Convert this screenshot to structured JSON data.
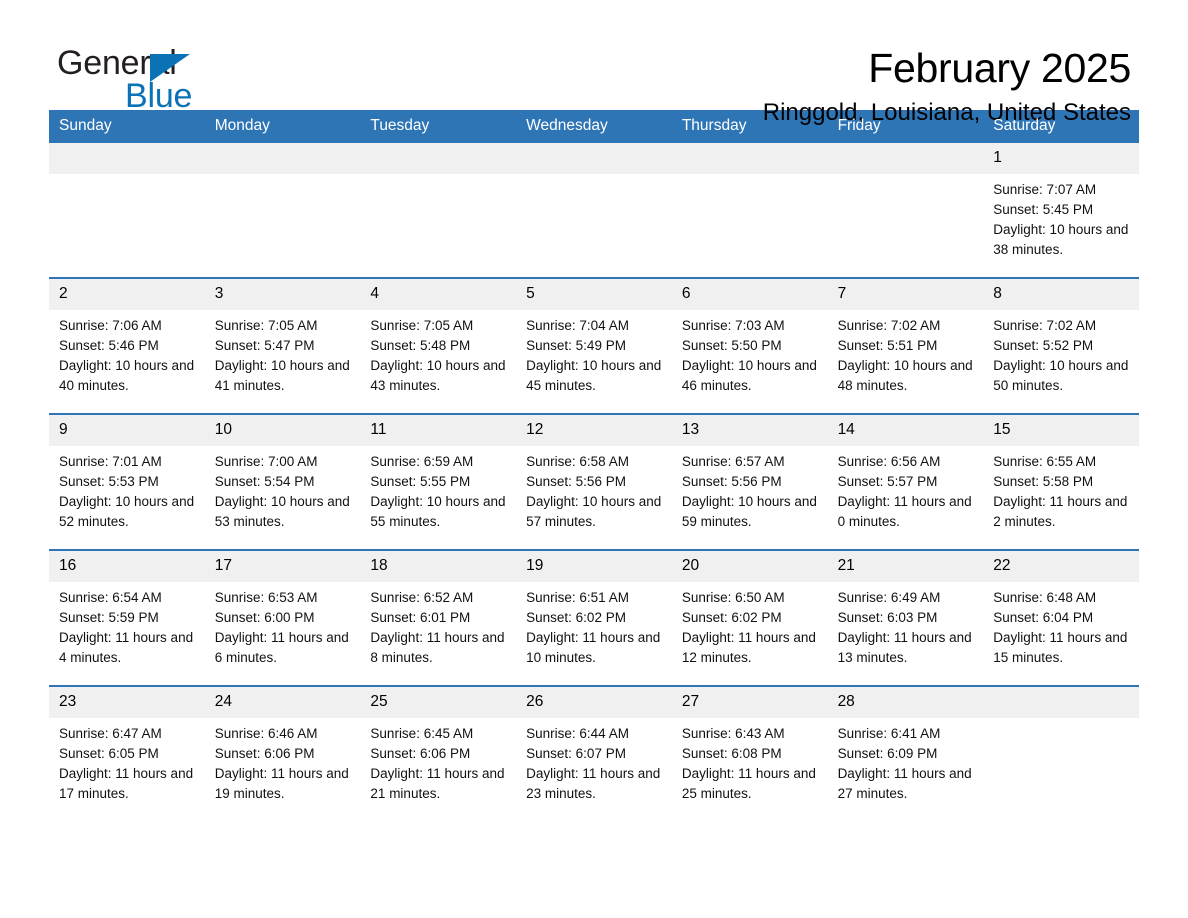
{
  "brand": {
    "name_part1": "General",
    "name_part2": "Blue",
    "accent_color": "#0b72b5"
  },
  "header": {
    "title": "February 2025",
    "subtitle": "Ringgold, Louisiana, United States",
    "header_bg": "#2e75b6",
    "daynum_bg": "#f0f0f0"
  },
  "weekdays": [
    "Sunday",
    "Monday",
    "Tuesday",
    "Wednesday",
    "Thursday",
    "Friday",
    "Saturday"
  ],
  "labels": {
    "sunrise": "Sunrise:",
    "sunset": "Sunset:",
    "daylight": "Daylight:"
  },
  "weeks": [
    [
      {
        "day": "",
        "sunrise": "",
        "sunset": "",
        "daylight": "",
        "empty": true
      },
      {
        "day": "",
        "sunrise": "",
        "sunset": "",
        "daylight": "",
        "empty": true
      },
      {
        "day": "",
        "sunrise": "",
        "sunset": "",
        "daylight": "",
        "empty": true
      },
      {
        "day": "",
        "sunrise": "",
        "sunset": "",
        "daylight": "",
        "empty": true
      },
      {
        "day": "",
        "sunrise": "",
        "sunset": "",
        "daylight": "",
        "empty": true
      },
      {
        "day": "",
        "sunrise": "",
        "sunset": "",
        "daylight": "",
        "empty": true
      },
      {
        "day": "1",
        "sunrise": "Sunrise: 7:07 AM",
        "sunset": "Sunset: 5:45 PM",
        "daylight": "Daylight: 10 hours and 38 minutes.",
        "empty": false
      }
    ],
    [
      {
        "day": "2",
        "sunrise": "Sunrise: 7:06 AM",
        "sunset": "Sunset: 5:46 PM",
        "daylight": "Daylight: 10 hours and 40 minutes.",
        "empty": false
      },
      {
        "day": "3",
        "sunrise": "Sunrise: 7:05 AM",
        "sunset": "Sunset: 5:47 PM",
        "daylight": "Daylight: 10 hours and 41 minutes.",
        "empty": false
      },
      {
        "day": "4",
        "sunrise": "Sunrise: 7:05 AM",
        "sunset": "Sunset: 5:48 PM",
        "daylight": "Daylight: 10 hours and 43 minutes.",
        "empty": false
      },
      {
        "day": "5",
        "sunrise": "Sunrise: 7:04 AM",
        "sunset": "Sunset: 5:49 PM",
        "daylight": "Daylight: 10 hours and 45 minutes.",
        "empty": false
      },
      {
        "day": "6",
        "sunrise": "Sunrise: 7:03 AM",
        "sunset": "Sunset: 5:50 PM",
        "daylight": "Daylight: 10 hours and 46 minutes.",
        "empty": false
      },
      {
        "day": "7",
        "sunrise": "Sunrise: 7:02 AM",
        "sunset": "Sunset: 5:51 PM",
        "daylight": "Daylight: 10 hours and 48 minutes.",
        "empty": false
      },
      {
        "day": "8",
        "sunrise": "Sunrise: 7:02 AM",
        "sunset": "Sunset: 5:52 PM",
        "daylight": "Daylight: 10 hours and 50 minutes.",
        "empty": false
      }
    ],
    [
      {
        "day": "9",
        "sunrise": "Sunrise: 7:01 AM",
        "sunset": "Sunset: 5:53 PM",
        "daylight": "Daylight: 10 hours and 52 minutes.",
        "empty": false
      },
      {
        "day": "10",
        "sunrise": "Sunrise: 7:00 AM",
        "sunset": "Sunset: 5:54 PM",
        "daylight": "Daylight: 10 hours and 53 minutes.",
        "empty": false
      },
      {
        "day": "11",
        "sunrise": "Sunrise: 6:59 AM",
        "sunset": "Sunset: 5:55 PM",
        "daylight": "Daylight: 10 hours and 55 minutes.",
        "empty": false
      },
      {
        "day": "12",
        "sunrise": "Sunrise: 6:58 AM",
        "sunset": "Sunset: 5:56 PM",
        "daylight": "Daylight: 10 hours and 57 minutes.",
        "empty": false
      },
      {
        "day": "13",
        "sunrise": "Sunrise: 6:57 AM",
        "sunset": "Sunset: 5:56 PM",
        "daylight": "Daylight: 10 hours and 59 minutes.",
        "empty": false
      },
      {
        "day": "14",
        "sunrise": "Sunrise: 6:56 AM",
        "sunset": "Sunset: 5:57 PM",
        "daylight": "Daylight: 11 hours and 0 minutes.",
        "empty": false
      },
      {
        "day": "15",
        "sunrise": "Sunrise: 6:55 AM",
        "sunset": "Sunset: 5:58 PM",
        "daylight": "Daylight: 11 hours and 2 minutes.",
        "empty": false
      }
    ],
    [
      {
        "day": "16",
        "sunrise": "Sunrise: 6:54 AM",
        "sunset": "Sunset: 5:59 PM",
        "daylight": "Daylight: 11 hours and 4 minutes.",
        "empty": false
      },
      {
        "day": "17",
        "sunrise": "Sunrise: 6:53 AM",
        "sunset": "Sunset: 6:00 PM",
        "daylight": "Daylight: 11 hours and 6 minutes.",
        "empty": false
      },
      {
        "day": "18",
        "sunrise": "Sunrise: 6:52 AM",
        "sunset": "Sunset: 6:01 PM",
        "daylight": "Daylight: 11 hours and 8 minutes.",
        "empty": false
      },
      {
        "day": "19",
        "sunrise": "Sunrise: 6:51 AM",
        "sunset": "Sunset: 6:02 PM",
        "daylight": "Daylight: 11 hours and 10 minutes.",
        "empty": false
      },
      {
        "day": "20",
        "sunrise": "Sunrise: 6:50 AM",
        "sunset": "Sunset: 6:02 PM",
        "daylight": "Daylight: 11 hours and 12 minutes.",
        "empty": false
      },
      {
        "day": "21",
        "sunrise": "Sunrise: 6:49 AM",
        "sunset": "Sunset: 6:03 PM",
        "daylight": "Daylight: 11 hours and 13 minutes.",
        "empty": false
      },
      {
        "day": "22",
        "sunrise": "Sunrise: 6:48 AM",
        "sunset": "Sunset: 6:04 PM",
        "daylight": "Daylight: 11 hours and 15 minutes.",
        "empty": false
      }
    ],
    [
      {
        "day": "23",
        "sunrise": "Sunrise: 6:47 AM",
        "sunset": "Sunset: 6:05 PM",
        "daylight": "Daylight: 11 hours and 17 minutes.",
        "empty": false
      },
      {
        "day": "24",
        "sunrise": "Sunrise: 6:46 AM",
        "sunset": "Sunset: 6:06 PM",
        "daylight": "Daylight: 11 hours and 19 minutes.",
        "empty": false
      },
      {
        "day": "25",
        "sunrise": "Sunrise: 6:45 AM",
        "sunset": "Sunset: 6:06 PM",
        "daylight": "Daylight: 11 hours and 21 minutes.",
        "empty": false
      },
      {
        "day": "26",
        "sunrise": "Sunrise: 6:44 AM",
        "sunset": "Sunset: 6:07 PM",
        "daylight": "Daylight: 11 hours and 23 minutes.",
        "empty": false
      },
      {
        "day": "27",
        "sunrise": "Sunrise: 6:43 AM",
        "sunset": "Sunset: 6:08 PM",
        "daylight": "Daylight: 11 hours and 25 minutes.",
        "empty": false
      },
      {
        "day": "28",
        "sunrise": "Sunrise: 6:41 AM",
        "sunset": "Sunset: 6:09 PM",
        "daylight": "Daylight: 11 hours and 27 minutes.",
        "empty": false
      },
      {
        "day": "",
        "sunrise": "",
        "sunset": "",
        "daylight": "",
        "empty": true
      }
    ]
  ]
}
